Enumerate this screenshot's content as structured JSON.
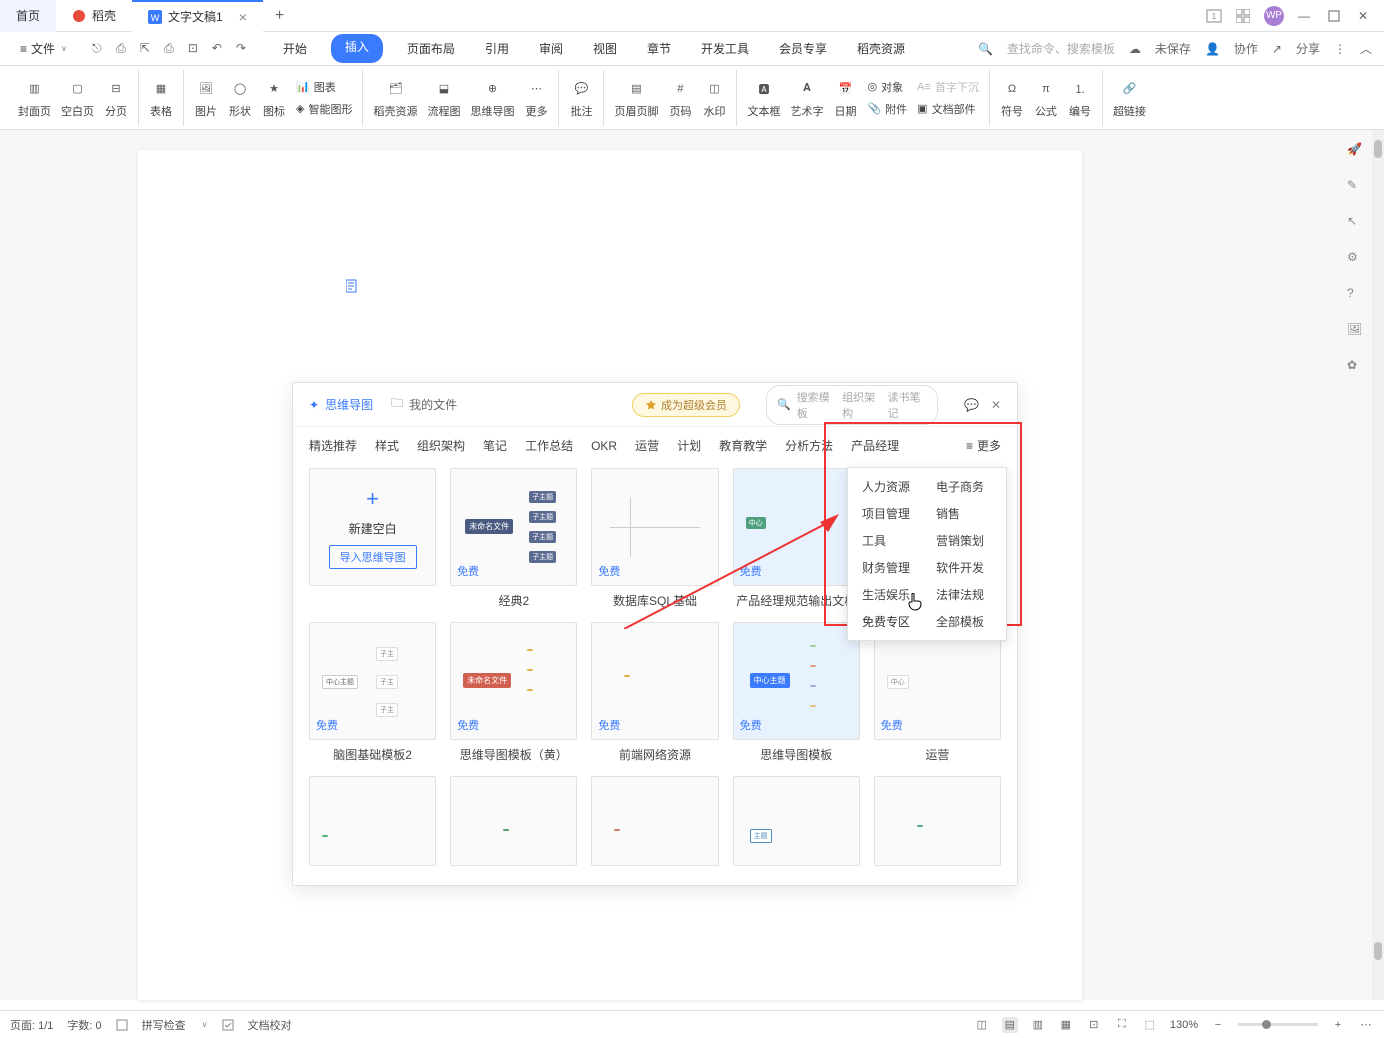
{
  "titlebar": {
    "home": "首页",
    "docker": "稻壳",
    "doc_tab": "文字文稿1",
    "wp": "WP"
  },
  "menubar": {
    "file": "文件",
    "tabs": [
      "开始",
      "插入",
      "页面布局",
      "引用",
      "审阅",
      "视图",
      "章节",
      "开发工具",
      "会员专享",
      "稻壳资源"
    ],
    "active_tab_index": 1,
    "search_placeholder": "查找命令、搜索模板",
    "unsaved": "未保存",
    "coop": "协作",
    "share": "分享"
  },
  "ribbon": {
    "cover": "封面页",
    "blank": "空白页",
    "pagebreak": "分页",
    "table": "表格",
    "picture": "图片",
    "shape": "形状",
    "icon": "图标",
    "chart": "图表",
    "smartart": "智能图形",
    "docker_res": "稻壳资源",
    "flowchart": "流程图",
    "mindmap": "思维导图",
    "more": "更多",
    "comment": "批注",
    "header_footer": "页眉页脚",
    "page_num": "页码",
    "watermark": "水印",
    "textbox": "文本框",
    "wordart": "艺术字",
    "date": "日期",
    "object": "对象",
    "attach": "附件",
    "dropcap": "首字下沉",
    "docparts": "文档部件",
    "symbol": "符号",
    "equation": "公式",
    "number": "编号",
    "hyperlink": "超链接"
  },
  "dialog": {
    "tab_mindmap": "思维导图",
    "tab_myfiles": "我的文件",
    "vip": "成为超级会员",
    "search_placeholder": "搜索模板",
    "search_tags": [
      "组织架构",
      "读书笔记"
    ],
    "categories": [
      "精选推荐",
      "样式",
      "组织架构",
      "笔记",
      "工作总结",
      "OKR",
      "运营",
      "计划",
      "教育教学",
      "分析方法",
      "产品经理"
    ],
    "more_label": "更多",
    "dropdown": {
      "col1": [
        "人力资源",
        "项目管理",
        "工具",
        "财务管理",
        "生活娱乐",
        "免费专区"
      ],
      "col2": [
        "电子商务",
        "销售",
        "营销策划",
        "软件开发",
        "法律法规",
        "全部模板"
      ]
    },
    "new_blank": "新建空白",
    "import": "导入思维导图",
    "free": "免费",
    "templates_row1": [
      "",
      "经典2",
      "数据库SQL基础",
      "产品经理规范输出文档",
      ""
    ],
    "templates_row2": [
      "脑图基础模板2",
      "思维导图模板（黄）",
      "前端网络资源",
      "思维导图模板",
      "运营"
    ],
    "templates_row3": [
      "",
      "",
      "",
      "",
      ""
    ]
  },
  "statusbar": {
    "page": "页面: 1/1",
    "words": "字数: 0",
    "spell": "拼写检查",
    "proof": "文档校对",
    "zoom": "130%"
  }
}
